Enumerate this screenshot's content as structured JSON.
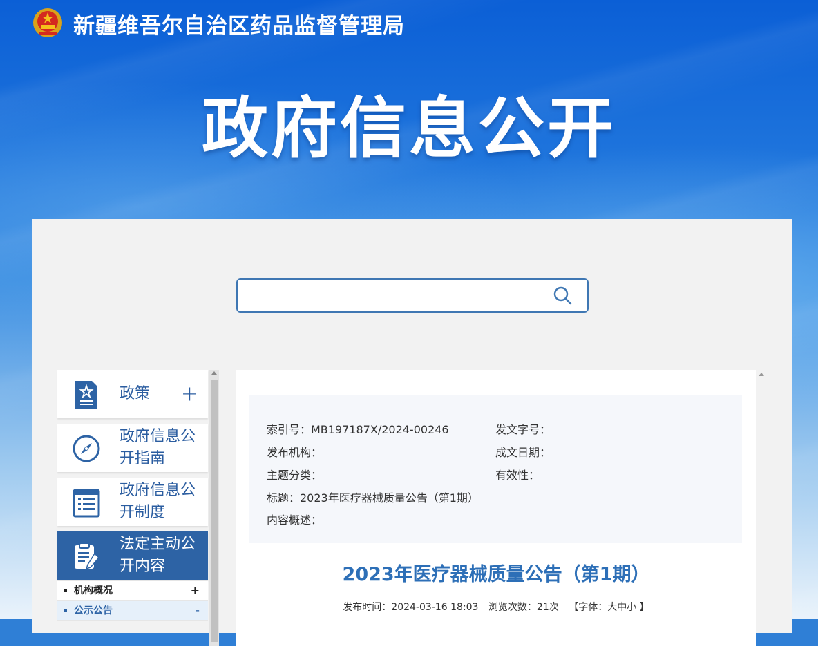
{
  "header": {
    "site_title": "新疆维吾尔自治区药品监督管理局",
    "hero_title": "政府信息公开"
  },
  "search": {
    "placeholder": ""
  },
  "sidebar": {
    "items": [
      {
        "label": "政策",
        "toggle": "+"
      },
      {
        "label": "政府信息公开指南",
        "toggle": ""
      },
      {
        "label": "政府信息公开制度",
        "toggle": ""
      },
      {
        "label": "法定主动公开内容",
        "toggle": "—"
      }
    ],
    "sub_items": [
      {
        "label": "机构概况",
        "toggle": "+"
      },
      {
        "label": "公示公告",
        "toggle": "-"
      }
    ]
  },
  "meta": {
    "index_no": "索引号：MB197187X/2024-00246",
    "doc_no": "发文字号：",
    "publisher": "发布机构：",
    "date_created": "成文日期：",
    "topic": "主题分类：",
    "validity": "有效性：",
    "title": "标题：2023年医疗器械质量公告（第1期）",
    "summary": "内容概述："
  },
  "document": {
    "title": "2023年医疗器械质量公告（第1期）",
    "publish_time": "发布时间：2024-03-16 18:03",
    "views": "浏览次数：21次",
    "font_size": "【字体：大中小 】"
  },
  "colors": {
    "primary": "#2d63a5",
    "title_blue": "#2d6fb7",
    "banner_top": "#0b5fd6"
  }
}
